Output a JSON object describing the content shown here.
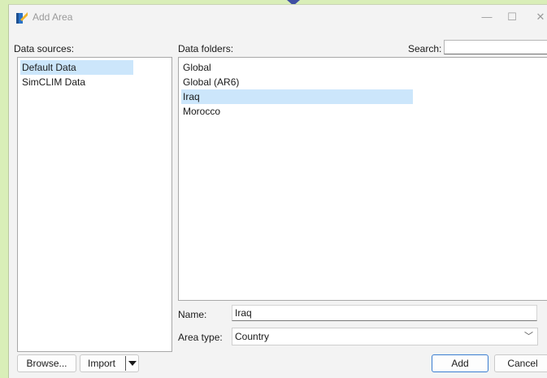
{
  "window": {
    "title": "Add Area",
    "minimize_glyph": "—",
    "maximize_glyph": "☐",
    "close_glyph": "✕"
  },
  "sources": {
    "label": "Data sources:",
    "items": [
      {
        "label": "Default Data",
        "selected": true
      },
      {
        "label": "SimCLIM Data",
        "selected": false
      }
    ]
  },
  "folders": {
    "label": "Data folders:",
    "items": [
      {
        "label": "Global",
        "selected": false
      },
      {
        "label": "Global (AR6)",
        "selected": false
      },
      {
        "label": "Iraq",
        "selected": true
      },
      {
        "label": "Morocco",
        "selected": false
      }
    ]
  },
  "search": {
    "label": "Search:",
    "value": ""
  },
  "form": {
    "name_label": "Name:",
    "name_value": "Iraq",
    "area_type_label": "Area type:",
    "area_type_value": "Country"
  },
  "buttons": {
    "browse": "Browse...",
    "import": "Import",
    "add": "Add",
    "cancel": "Cancel"
  },
  "colors": {
    "selection": "#cce6fb",
    "desktop": "#d9eeb8",
    "default_button_border": "#3b7ed1"
  }
}
